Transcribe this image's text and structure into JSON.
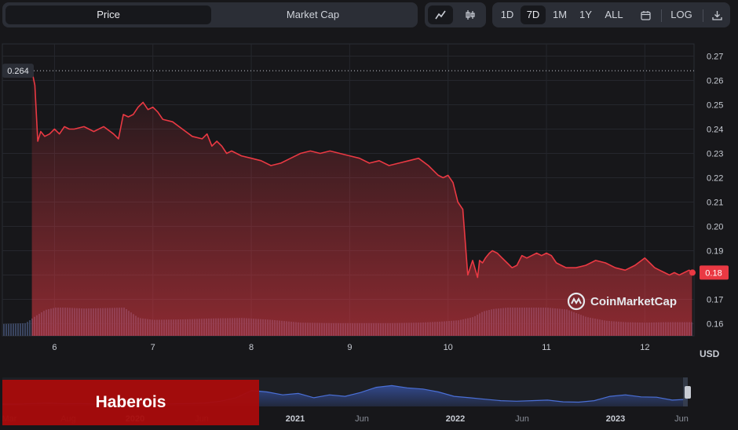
{
  "toolbar": {
    "metric_tabs": [
      {
        "label": "Price",
        "active": true
      },
      {
        "label": "Market Cap",
        "active": false
      }
    ],
    "chart_type_icons": [
      "line-chart-icon",
      "candlestick-icon"
    ],
    "ranges": [
      "1D",
      "7D",
      "1M",
      "1Y",
      "ALL"
    ],
    "active_range": "7D",
    "log_label": "LOG",
    "calendar_icon": "calendar-icon",
    "download_icon": "download-icon"
  },
  "brand_overlay": "Haberois",
  "watermark": "CoinMarketCap",
  "currency_label": "USD",
  "colors": {
    "background": "#17171a",
    "line": "#ea3943",
    "volume": "#3a4560",
    "navigator": "#3d5fc4",
    "overlay": "#a80b0b"
  },
  "chart_data": {
    "type": "line",
    "currency": "USD",
    "ylim": [
      0.155,
      0.275
    ],
    "y_ticks": [
      0.27,
      0.26,
      0.25,
      0.24,
      0.23,
      0.22,
      0.21,
      0.2,
      0.19,
      0.18,
      0.17,
      0.16
    ],
    "y_tick_labels": [
      "0.27",
      "0.26",
      "0.25",
      "0.24",
      "0.23",
      "0.22",
      "0.21",
      "0.20",
      "0.19",
      "0.18",
      "0.17",
      "0.16"
    ],
    "x_ticks": [
      6,
      7,
      8,
      9,
      10,
      11,
      12
    ],
    "x_tick_labels": [
      "6",
      "7",
      "8",
      "9",
      "10",
      "11",
      "12"
    ],
    "xlim": [
      5.47,
      12.5
    ],
    "high_label": "0.264",
    "high_value": 0.264,
    "current_label": "0.18",
    "current_value": 0.181,
    "series": [
      {
        "x": [
          5.77,
          5.8,
          5.83,
          5.86,
          5.9,
          5.95,
          6.0,
          6.05,
          6.1,
          6.15,
          6.2,
          6.3,
          6.4,
          6.5,
          6.6,
          6.65,
          6.7,
          6.75,
          6.8,
          6.85,
          6.9,
          6.95,
          7.0,
          7.05,
          7.1,
          7.2,
          7.3,
          7.4,
          7.5,
          7.55,
          7.6,
          7.65,
          7.7,
          7.75,
          7.8,
          7.9,
          8.0,
          8.1,
          8.2,
          8.3,
          8.4,
          8.5,
          8.6,
          8.7,
          8.8,
          8.9,
          9.0,
          9.1,
          9.2,
          9.3,
          9.4,
          9.5,
          9.6,
          9.7,
          9.8,
          9.85,
          9.9,
          9.95,
          10.0,
          10.05,
          10.1,
          10.15,
          10.2,
          10.25,
          10.3,
          10.32,
          10.35,
          10.38,
          10.42,
          10.45,
          10.5,
          10.55,
          10.6,
          10.65,
          10.7,
          10.75,
          10.8,
          10.85,
          10.9,
          10.95,
          11.0,
          11.05,
          11.1,
          11.15,
          11.2,
          11.3,
          11.4,
          11.5,
          11.6,
          11.7,
          11.8,
          11.9,
          12.0,
          12.05,
          12.1,
          12.15,
          12.2,
          12.25,
          12.3,
          12.35,
          12.4,
          12.45,
          12.48
        ],
        "values": [
          0.264,
          0.258,
          0.235,
          0.239,
          0.237,
          0.238,
          0.24,
          0.238,
          0.241,
          0.24,
          0.24,
          0.241,
          0.239,
          0.241,
          0.238,
          0.236,
          0.246,
          0.245,
          0.246,
          0.249,
          0.251,
          0.248,
          0.249,
          0.247,
          0.244,
          0.243,
          0.24,
          0.237,
          0.236,
          0.238,
          0.233,
          0.235,
          0.233,
          0.23,
          0.231,
          0.229,
          0.228,
          0.227,
          0.225,
          0.226,
          0.228,
          0.23,
          0.231,
          0.23,
          0.231,
          0.23,
          0.229,
          0.228,
          0.226,
          0.227,
          0.225,
          0.226,
          0.227,
          0.228,
          0.225,
          0.223,
          0.221,
          0.22,
          0.221,
          0.218,
          0.21,
          0.207,
          0.18,
          0.186,
          0.179,
          0.186,
          0.185,
          0.187,
          0.189,
          0.19,
          0.189,
          0.187,
          0.185,
          0.183,
          0.184,
          0.188,
          0.187,
          0.188,
          0.189,
          0.188,
          0.189,
          0.188,
          0.185,
          0.184,
          0.183,
          0.183,
          0.184,
          0.186,
          0.185,
          0.183,
          0.182,
          0.184,
          0.187,
          0.185,
          0.183,
          0.182,
          0.181,
          0.18,
          0.181,
          0.18,
          0.181,
          0.182,
          0.181
        ]
      }
    ],
    "volume": {
      "x": [
        5.47,
        5.7,
        5.8,
        5.9,
        6.0,
        6.1,
        6.3,
        6.5,
        6.7,
        6.85,
        7.0,
        7.3,
        7.6,
        7.9,
        8.2,
        8.5,
        8.8,
        9.1,
        9.4,
        9.7,
        9.9,
        10.1,
        10.25,
        10.35,
        10.45,
        10.6,
        10.8,
        11.0,
        11.2,
        11.4,
        11.6,
        11.8,
        12.0,
        12.2,
        12.5
      ],
      "values": [
        0.25,
        0.27,
        0.42,
        0.55,
        0.6,
        0.6,
        0.58,
        0.59,
        0.6,
        0.38,
        0.34,
        0.35,
        0.37,
        0.38,
        0.34,
        0.28,
        0.27,
        0.27,
        0.27,
        0.28,
        0.3,
        0.33,
        0.4,
        0.52,
        0.57,
        0.6,
        0.6,
        0.6,
        0.56,
        0.4,
        0.32,
        0.29,
        0.28,
        0.29,
        0.29
      ]
    },
    "navigator": {
      "x_tick_labels": [
        "Mar",
        "Aug",
        "2020",
        "Jun",
        "2021",
        "Jun",
        "2022",
        "Jun",
        "2023",
        "Jun"
      ],
      "values": [
        0.08,
        0.08,
        0.1,
        0.12,
        0.09,
        0.1,
        0.08,
        0.09,
        0.11,
        0.12,
        0.08,
        0.09,
        0.1,
        0.12,
        0.18,
        0.3,
        0.55,
        0.5,
        0.4,
        0.45,
        0.3,
        0.4,
        0.35,
        0.48,
        0.66,
        0.72,
        0.64,
        0.6,
        0.5,
        0.35,
        0.3,
        0.25,
        0.2,
        0.18,
        0.2,
        0.22,
        0.16,
        0.15,
        0.2,
        0.35,
        0.4,
        0.33,
        0.32,
        0.22,
        0.25
      ]
    }
  }
}
